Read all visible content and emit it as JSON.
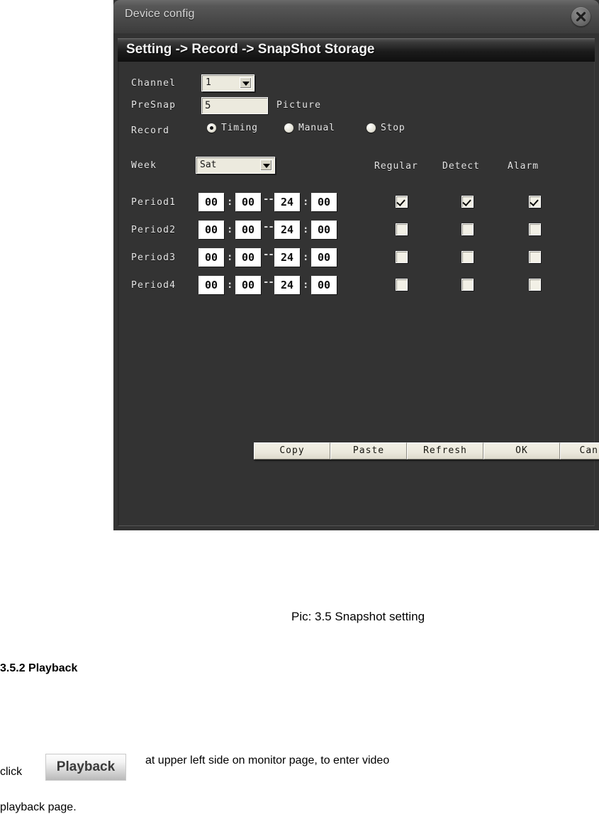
{
  "dialog": {
    "title": "Device config",
    "close_icon": "close-circle-icon",
    "section_header": "Setting -> Record -> SnapShot Storage",
    "fields": {
      "channel_label": "Channel",
      "channel_value": "1",
      "presnap_label": "PreSnap",
      "presnap_value": "5",
      "presnap_unit": "Picture",
      "record_label": "Record",
      "week_label": "Week",
      "week_value": "Sat"
    },
    "record_modes": [
      {
        "label": "Timing",
        "selected": true
      },
      {
        "label": "Manual",
        "selected": false
      },
      {
        "label": "Stop",
        "selected": false
      }
    ],
    "column_headers": [
      "Regular",
      "Detect",
      "Alarm"
    ],
    "periods": [
      {
        "label": "Period1",
        "start_hour": "00",
        "start_min": "00",
        "end_hour": "24",
        "end_min": "00",
        "regular": true,
        "detect": true,
        "alarm": true
      },
      {
        "label": "Period2",
        "start_hour": "00",
        "start_min": "00",
        "end_hour": "24",
        "end_min": "00",
        "regular": false,
        "detect": false,
        "alarm": false
      },
      {
        "label": "Period3",
        "start_hour": "00",
        "start_min": "00",
        "end_hour": "24",
        "end_min": "00",
        "regular": false,
        "detect": false,
        "alarm": false
      },
      {
        "label": "Period4",
        "start_hour": "00",
        "start_min": "00",
        "end_hour": "24",
        "end_min": "00",
        "regular": false,
        "detect": false,
        "alarm": false
      }
    ],
    "separators": {
      "colon": ":",
      "dash": "--"
    },
    "buttons": [
      "Copy",
      "Paste",
      "Refresh",
      "OK",
      "Cancel"
    ]
  },
  "document": {
    "figure_caption": "Pic: 3.5 Snapshot setting",
    "heading": "3.5.2 Playback",
    "click_word": "click",
    "playback_button_label": "Playback",
    "sentence": "at upper left side on monitor page, to enter video",
    "sentence_continued": "playback page."
  },
  "colors": {
    "dialog_bg": "#333333",
    "titlebar": "#4a4a4a",
    "input_bg": "#eceade",
    "text_light": "#e8e8e8"
  }
}
